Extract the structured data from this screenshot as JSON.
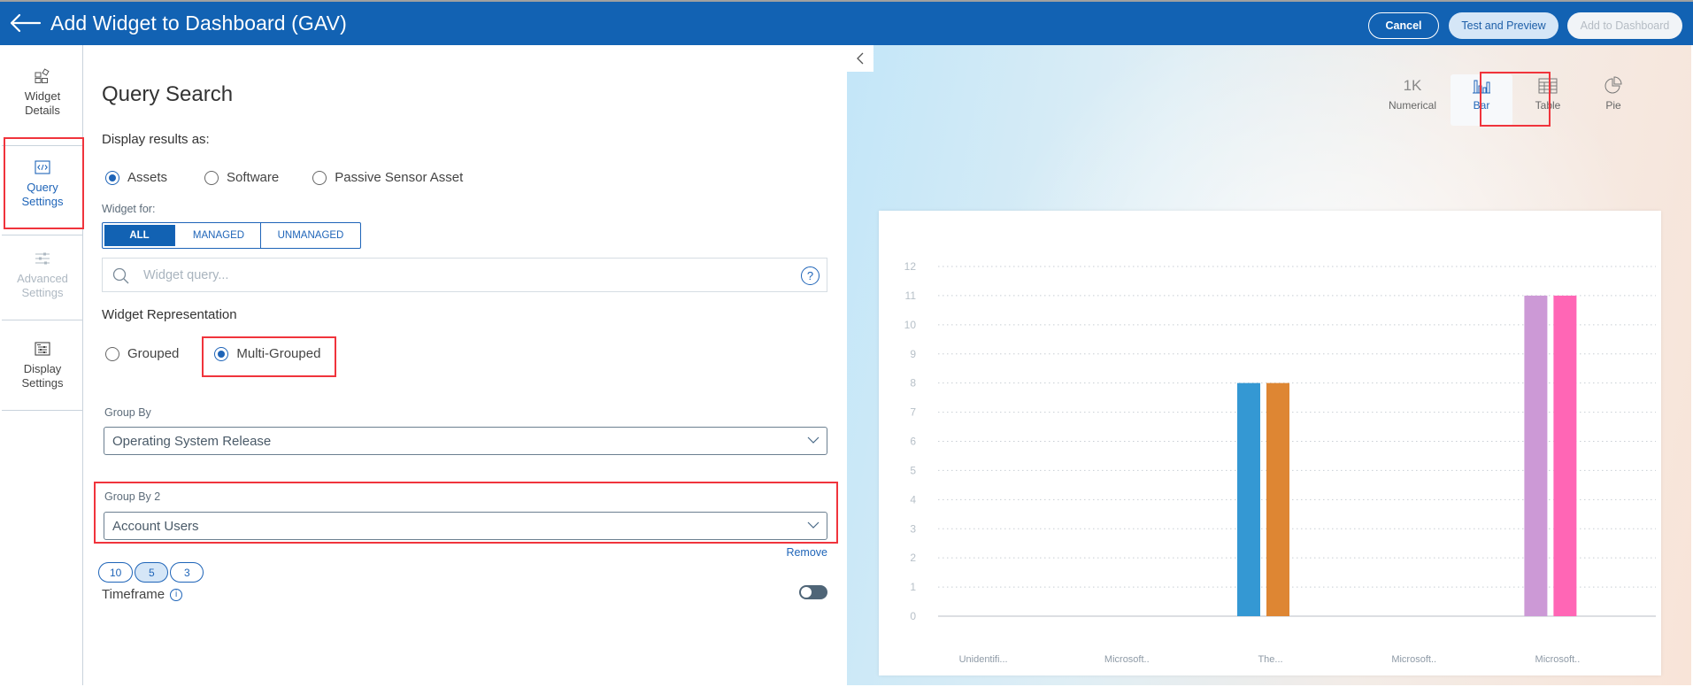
{
  "header": {
    "title": "Add Widget to Dashboard (GAV)",
    "back_icon": "arrow-left-icon",
    "buttons": {
      "cancel": "Cancel",
      "test_preview": "Test and Preview",
      "add_to_dashboard": "Add to Dashboard"
    }
  },
  "sidebar": {
    "items": [
      {
        "id": "widget-details",
        "label_line1": "Widget",
        "label_line2": "Details",
        "icon": "widgets-icon",
        "state": "normal"
      },
      {
        "id": "query-settings",
        "label_line1": "Query",
        "label_line2": "Settings",
        "icon": "code-icon",
        "state": "active"
      },
      {
        "id": "advanced-settings",
        "label_line1": "Advanced",
        "label_line2": "Settings",
        "icon": "sliders-icon",
        "state": "disabled"
      },
      {
        "id": "display-settings",
        "label_line1": "Display",
        "label_line2": "Settings",
        "icon": "display-settings-icon",
        "state": "normal"
      }
    ]
  },
  "form": {
    "title": "Query Search",
    "display_results_label": "Display results as:",
    "display_results_options": [
      {
        "label": "Assets",
        "selected": true
      },
      {
        "label": "Software",
        "selected": false
      },
      {
        "label": "Passive Sensor Asset",
        "selected": false
      }
    ],
    "widget_for_label": "Widget for:",
    "widget_for_options": [
      {
        "label": "ALL",
        "selected": true
      },
      {
        "label": "MANAGED",
        "selected": false
      },
      {
        "label": "UNMANAGED",
        "selected": false
      }
    ],
    "query": {
      "value": "",
      "placeholder": "Widget query...",
      "help": "?"
    },
    "representation_label": "Widget Representation",
    "representation_options": [
      {
        "label": "Grouped",
        "selected": false
      },
      {
        "label": "Multi-Grouped",
        "selected": true
      }
    ],
    "group_by": {
      "label": "Group By",
      "value": "Operating System Release"
    },
    "group_by_2": {
      "label": "Group By 2",
      "value": "Account Users"
    },
    "remove_label": "Remove",
    "limit_options": [
      {
        "label": "10",
        "selected": false
      },
      {
        "label": "5",
        "selected": true
      },
      {
        "label": "3",
        "selected": false
      }
    ],
    "timeframe": {
      "label": "Timeframe",
      "info": "i",
      "enabled": false
    }
  },
  "preview": {
    "chart_types": [
      {
        "id": "numerical",
        "label": "Numerical",
        "icon_text": "1K",
        "selected": false
      },
      {
        "id": "bar",
        "label": "Bar",
        "icon_text": "",
        "selected": true
      },
      {
        "id": "table",
        "label": "Table",
        "icon_text": "",
        "selected": false
      },
      {
        "id": "pie",
        "label": "Pie",
        "icon_text": "",
        "selected": false
      }
    ]
  },
  "colors": {
    "brand": "#1262b3",
    "highlight": "#f0343c",
    "series": [
      "#3498d3",
      "#de8633",
      "#cc99d6",
      "#ff66b5"
    ]
  },
  "chart_data": {
    "type": "bar",
    "title": "",
    "xlabel": "",
    "ylabel": "",
    "ylim": [
      0,
      12
    ],
    "yticks": [
      0,
      1,
      2,
      3,
      4,
      5,
      6,
      7,
      8,
      9,
      10,
      11,
      12
    ],
    "grid": true,
    "categories": [
      "Unidentifi...",
      "Microsoft..",
      "The...",
      "Microsoft..",
      "Microsoft.."
    ],
    "bars": [
      {
        "category_index": 2,
        "value": 8,
        "color": "#3498d3"
      },
      {
        "category_index": 2,
        "value": 8,
        "color": "#de8633"
      },
      {
        "category_index": 4,
        "value": 11,
        "color": "#cc99d6"
      },
      {
        "category_index": 4,
        "value": 11,
        "color": "#ff66b5"
      }
    ]
  }
}
